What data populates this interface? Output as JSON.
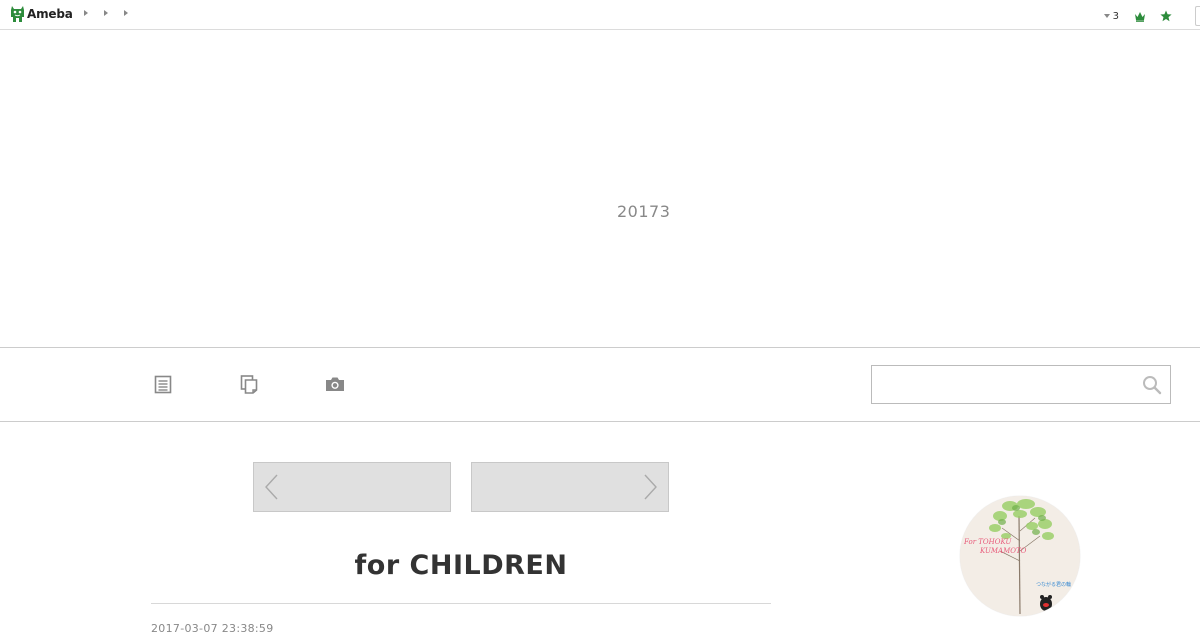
{
  "topbar": {
    "brand": "Ameba",
    "notification_count": "3",
    "icons": {
      "logo": "ameba-logo-icon",
      "notification": "chevron-down-icon",
      "crown": "crown-icon",
      "star": "star-icon"
    },
    "colors": {
      "brand_green": "#2d8c3c"
    }
  },
  "header": {
    "text": "20173"
  },
  "navbar": {
    "icons": [
      "entries-list-icon",
      "themes-icon",
      "camera-icon"
    ],
    "search": {
      "placeholder": "",
      "value": "",
      "icon": "search-icon"
    }
  },
  "pager": {
    "prev_icon": "chevron-left-icon",
    "next_icon": "chevron-right-icon"
  },
  "entry": {
    "title": "for CHILDREN",
    "date": "2017-03-07 23:38:59"
  },
  "profile": {
    "line1": "For  TOHOKU",
    "line2": "KUMAMOTO",
    "line3": "つながる君の輪"
  }
}
